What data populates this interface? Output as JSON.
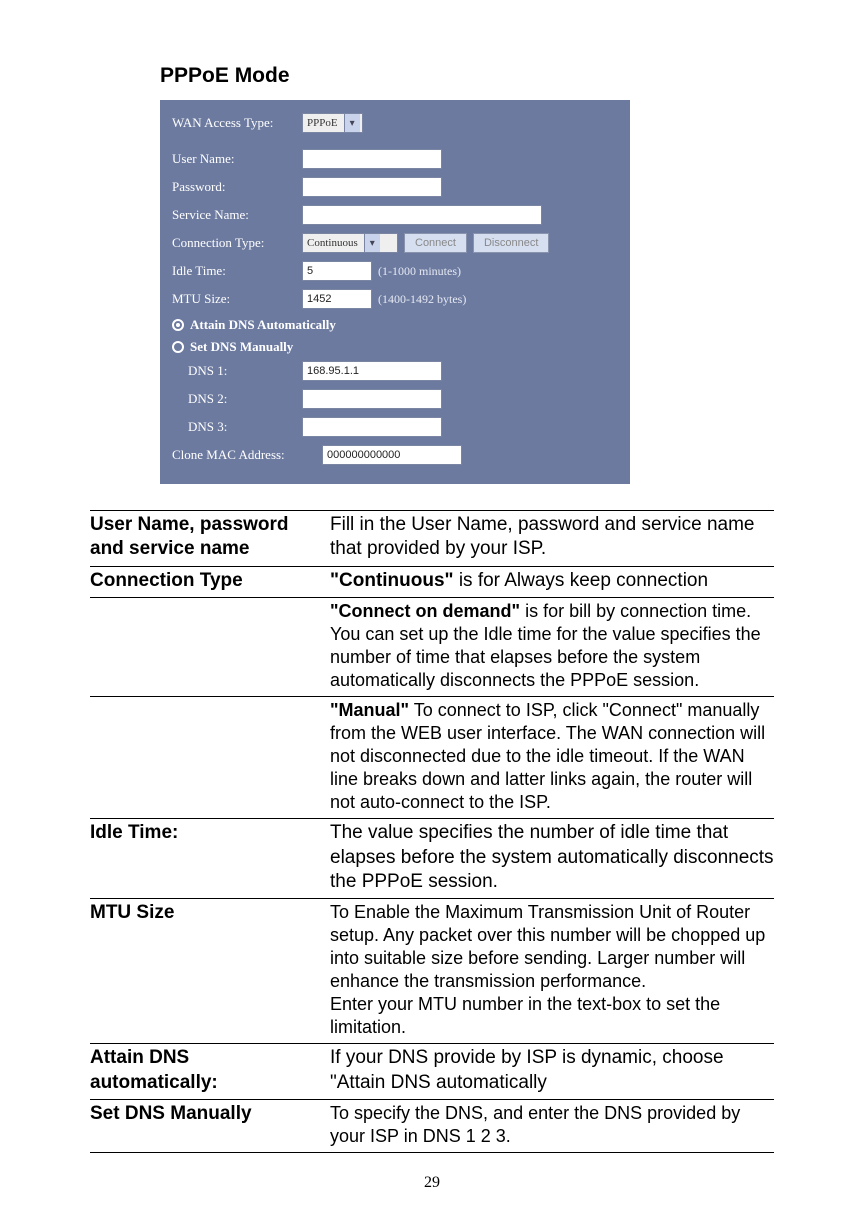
{
  "heading": "PPPoE Mode",
  "panel": {
    "wan_access_type_label": "WAN Access Type:",
    "wan_access_type_value": "PPPoE",
    "user_name_label": "User Name:",
    "user_name_value": "",
    "password_label": "Password:",
    "password_value": "",
    "service_name_label": "Service Name:",
    "service_name_value": "",
    "connection_type_label": "Connection Type:",
    "connection_type_value": "Continuous",
    "connect_btn": "Connect",
    "disconnect_btn": "Disconnect",
    "idle_time_label": "Idle Time:",
    "idle_time_value": "5",
    "idle_time_note": "(1-1000 minutes)",
    "mtu_size_label": "MTU Size:",
    "mtu_size_value": "1452",
    "mtu_size_note": "(1400-1492 bytes)",
    "radio_attain": "Attain DNS Automatically",
    "radio_set": "Set DNS Manually",
    "dns1_label": "DNS 1:",
    "dns1_value": "168.95.1.1",
    "dns2_label": "DNS 2:",
    "dns2_value": "",
    "dns3_label": "DNS 3:",
    "dns3_value": "",
    "clone_mac_label": "Clone MAC Address:",
    "clone_mac_value": "000000000000"
  },
  "table": {
    "rows": [
      {
        "term": "User Name, password and service name",
        "def_lead": "",
        "def_rest": "Fill in the User Name, password and service name that provided by your ISP."
      },
      {
        "term": "Connection Type",
        "def_lead": "\"Continuous\"",
        "def_rest": " is for Always keep connection"
      },
      {
        "term": "",
        "def_lead": "\"Connect on demand\"",
        "def_rest": " is for bill by connection time. You can set up the Idle time for the value specifies the number of time that elapses before the system automatically disconnects the PPPoE session."
      },
      {
        "term": "",
        "def_lead": "\"Manual\"",
        "def_rest": " To connect to ISP, click \"Connect\" manually from the WEB user interface. The WAN connection will not disconnected due to the idle timeout. If the WAN line breaks down and latter links again, the router will not auto-connect to the ISP."
      },
      {
        "term": "Idle Time:",
        "def_lead": "",
        "def_rest": "The value specifies the number of idle time that elapses before the system automatically disconnects the PPPoE session."
      },
      {
        "term": "MTU Size",
        "def_lead": "",
        "def_rest": "To Enable the Maximum Transmission Unit of Router setup. Any packet over this number will be chopped up into suitable size before sending. Larger number will enhance the transmission performance.\nEnter your MTU number in the text-box to set the limitation."
      },
      {
        "term": "Attain DNS automatically:",
        "def_lead": "",
        "def_rest": "If your DNS provide by ISP is dynamic, choose \"Attain DNS automatically"
      },
      {
        "term": "Set DNS Manually",
        "def_lead": "",
        "def_rest": "To specify the DNS, and enter the DNS provided by your ISP in DNS 1 2 3."
      }
    ]
  },
  "page_number": "29"
}
